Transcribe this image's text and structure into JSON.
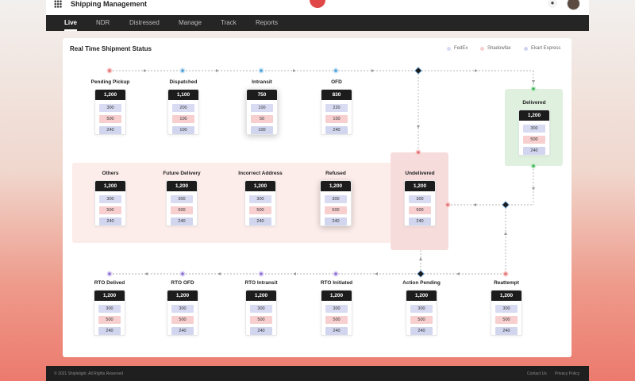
{
  "app": {
    "title": "Shipping Management"
  },
  "tabs": [
    "Live",
    "NDR",
    "Distressed",
    "Manage",
    "Track",
    "Reports"
  ],
  "active_tab": "Live",
  "panel": {
    "title": "Real Time Shipment Status"
  },
  "legend": [
    {
      "label": "FedEx",
      "color": "#d8dbf2"
    },
    {
      "label": "Shadowfax",
      "color": "#f7cfcf"
    },
    {
      "label": "Ekart Express",
      "color": "#cfd3ef"
    }
  ],
  "nodes": [
    {
      "id": "pending-pickup",
      "label": "Pending Pickup",
      "total": "1,200",
      "values": [
        "300",
        "500",
        "240"
      ]
    },
    {
      "id": "dispatched",
      "label": "Dispatched",
      "total": "1,100",
      "values": [
        "200",
        "100",
        "100"
      ]
    },
    {
      "id": "intransit",
      "label": "Intransit",
      "total": "750",
      "values": [
        "100",
        "50",
        "100"
      ]
    },
    {
      "id": "ofd",
      "label": "OFD",
      "total": "830",
      "values": [
        "220",
        "100",
        "240"
      ]
    },
    {
      "id": "delivered",
      "label": "Delivered",
      "total": "1,200",
      "values": [
        "300",
        "500",
        "240"
      ]
    },
    {
      "id": "others",
      "label": "Others",
      "total": "1,200",
      "values": [
        "300",
        "500",
        "240"
      ]
    },
    {
      "id": "future-delivery",
      "label": "Future Delivery",
      "total": "1,200",
      "values": [
        "300",
        "500",
        "240"
      ]
    },
    {
      "id": "incorrect-address",
      "label": "Incorrect Address",
      "total": "1,200",
      "values": [
        "300",
        "500",
        "240"
      ]
    },
    {
      "id": "refused",
      "label": "Refused",
      "total": "1,200",
      "values": [
        "300",
        "500",
        "240"
      ]
    },
    {
      "id": "undelivered",
      "label": "Undelivered",
      "total": "1,200",
      "values": [
        "300",
        "500",
        "240"
      ]
    },
    {
      "id": "rto-delivered",
      "label": "RTO Delived",
      "total": "1,200",
      "values": [
        "300",
        "500",
        "240"
      ]
    },
    {
      "id": "rto-ofd",
      "label": "RTO OFD",
      "total": "1,200",
      "values": [
        "300",
        "500",
        "240"
      ]
    },
    {
      "id": "rto-intransit",
      "label": "RTO Intransit",
      "total": "1,200",
      "values": [
        "300",
        "500",
        "240"
      ]
    },
    {
      "id": "rto-initiated",
      "label": "RTO Initiated",
      "total": "1,200",
      "values": [
        "300",
        "500",
        "240"
      ]
    },
    {
      "id": "action-pending",
      "label": "Action Pending",
      "total": "1,200",
      "values": [
        "300",
        "500",
        "240"
      ]
    },
    {
      "id": "reattempt",
      "label": "Reattempt",
      "total": "1,200",
      "values": [
        "300",
        "500",
        "240"
      ]
    }
  ],
  "footer": {
    "copyright": "© 2021 Shiplelight. All Rights Reserved",
    "links": [
      "Contact Us",
      "Privacy Policy"
    ]
  }
}
